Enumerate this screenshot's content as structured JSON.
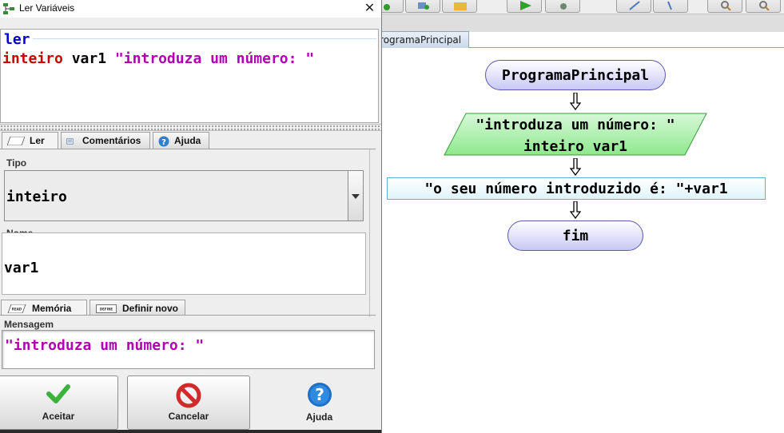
{
  "window": {
    "title": "Ler Variáveis"
  },
  "code_preview": {
    "line1": "ler",
    "line2": {
      "type": "inteiro",
      "var": "var1",
      "prompt": "\"introduza um número: \""
    }
  },
  "tabs": {
    "ler": "Ler",
    "comentarios": "Comentários",
    "ajuda": "Ajuda"
  },
  "fields": {
    "tipo_label": "Tipo",
    "tipo_value": "inteiro",
    "nome_label": "Nome",
    "nome_value": "var1",
    "mensagem_label": "Mensagem",
    "mensagem_value": "\"introduza um número: \""
  },
  "subtabs": {
    "memoria": "Memória",
    "definir_novo": "Definir novo",
    "read_tag": "READ",
    "define_tag": "DEFINE"
  },
  "buttons": {
    "aceitar": "Aceitar",
    "cancelar": "Cancelar",
    "ajuda": "Ajuda"
  },
  "editor": {
    "tab_label": "ProgramaPrincipal",
    "flowchart": {
      "start": "ProgramaPrincipal",
      "read_line1": "\"introduza um número: \"",
      "read_line2": "inteiro var1",
      "write": "\"o seu número introduzido é: \"+var1",
      "end": "fim"
    }
  },
  "colors": {
    "keyword_blue": "#0000cc",
    "type_red": "#cc0000",
    "string_magenta": "#b000b0",
    "read_green": "#9ef09e",
    "terminal_blue": "#c8c8f6"
  }
}
